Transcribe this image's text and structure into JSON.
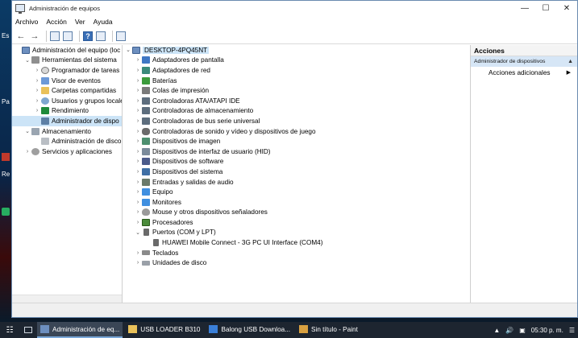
{
  "desktop": {
    "frag_1": "Es",
    "frag_2": "Pa",
    "frag_3": "Re"
  },
  "window": {
    "title": "Administración de equipos",
    "controls": {
      "minimize": "—",
      "maximize": "☐",
      "close": "✕"
    }
  },
  "menu": [
    "Archivo",
    "Acción",
    "Ver",
    "Ayuda"
  ],
  "left_tree": [
    {
      "label": "Administración del equipo (loc",
      "arrow": "",
      "icon": "ico-comp",
      "indent": 0
    },
    {
      "label": "Herramientas del sistema",
      "arrow": "⌄",
      "icon": "ico-tools",
      "indent": 1
    },
    {
      "label": "Programador de tareas",
      "arrow": "›",
      "icon": "ico-clock",
      "indent": 2
    },
    {
      "label": "Visor de eventos",
      "arrow": "›",
      "icon": "ico-event",
      "indent": 2
    },
    {
      "label": "Carpetas compartidas",
      "arrow": "›",
      "icon": "ico-folder",
      "indent": 2
    },
    {
      "label": "Usuarios y grupos locale",
      "arrow": "›",
      "icon": "ico-users",
      "indent": 2
    },
    {
      "label": "Rendimiento",
      "arrow": "›",
      "icon": "ico-perf",
      "indent": 2
    },
    {
      "label": "Administrador de dispo",
      "arrow": "",
      "icon": "ico-device",
      "indent": 2,
      "selected": true
    },
    {
      "label": "Almacenamiento",
      "arrow": "⌄",
      "icon": "ico-storage",
      "indent": 1
    },
    {
      "label": "Administración de disco",
      "arrow": "",
      "icon": "ico-disk",
      "indent": 2
    },
    {
      "label": "Servicios y aplicaciones",
      "arrow": "›",
      "icon": "ico-services",
      "indent": 1
    }
  ],
  "device_tree": {
    "root": "DESKTOP-4PQ45NT",
    "items": [
      {
        "label": "Adaptadores de pantalla",
        "arrow": "›",
        "icon": "ico-display",
        "indent": 1
      },
      {
        "label": "Adaptadores de red",
        "arrow": "›",
        "icon": "ico-net",
        "indent": 1
      },
      {
        "label": "Baterías",
        "arrow": "›",
        "icon": "ico-battery",
        "indent": 1
      },
      {
        "label": "Colas de impresión",
        "arrow": "›",
        "icon": "ico-print",
        "indent": 1
      },
      {
        "label": "Controladoras ATA/ATAPI IDE",
        "arrow": "›",
        "icon": "ico-ctrl",
        "indent": 1
      },
      {
        "label": "Controladoras de almacenamiento",
        "arrow": "›",
        "icon": "ico-ctrl",
        "indent": 1
      },
      {
        "label": "Controladoras de bus serie universal",
        "arrow": "›",
        "icon": "ico-ctrl",
        "indent": 1
      },
      {
        "label": "Controladoras de sonido y vídeo y dispositivos de juego",
        "arrow": "›",
        "icon": "ico-sound",
        "indent": 1
      },
      {
        "label": "Dispositivos de imagen",
        "arrow": "›",
        "icon": "ico-image",
        "indent": 1
      },
      {
        "label": "Dispositivos de interfaz de usuario (HID)",
        "arrow": "›",
        "icon": "ico-hid",
        "indent": 1
      },
      {
        "label": "Dispositivos de software",
        "arrow": "›",
        "icon": "ico-soft",
        "indent": 1
      },
      {
        "label": "Dispositivos del sistema",
        "arrow": "›",
        "icon": "ico-sys",
        "indent": 1
      },
      {
        "label": "Entradas y salidas de audio",
        "arrow": "›",
        "icon": "ico-audio",
        "indent": 1
      },
      {
        "label": "Equipo",
        "arrow": "›",
        "icon": "ico-monitor",
        "indent": 1
      },
      {
        "label": "Monitores",
        "arrow": "›",
        "icon": "ico-monitor",
        "indent": 1
      },
      {
        "label": "Mouse y otros dispositivos señaladores",
        "arrow": "›",
        "icon": "ico-mouse",
        "indent": 1
      },
      {
        "label": "Procesadores",
        "arrow": "›",
        "icon": "ico-cpu",
        "indent": 1
      },
      {
        "label": "Puertos (COM y LPT)",
        "arrow": "⌄",
        "icon": "ico-port",
        "indent": 1
      },
      {
        "label": "HUAWEI Mobile Connect - 3G PC UI Interface (COM4)",
        "arrow": "",
        "icon": "ico-port",
        "indent": 2
      },
      {
        "label": "Teclados",
        "arrow": "›",
        "icon": "ico-kbd",
        "indent": 1
      },
      {
        "label": "Unidades de disco",
        "arrow": "›",
        "icon": "ico-hdd",
        "indent": 1
      }
    ]
  },
  "actions": {
    "header": "Acciones",
    "section": "Administrador de dispositivos",
    "item": "Acciones adicionales"
  },
  "taskbar": {
    "items": [
      {
        "label": "Administración de eq...",
        "active": true,
        "color": "#6d8fbf"
      },
      {
        "label": "USB LOADER B310",
        "active": false,
        "color": "#e9c15a"
      },
      {
        "label": "Balong USB Downloa...",
        "active": false,
        "color": "#3a7fd8"
      },
      {
        "label": "Sin título - Paint",
        "active": false,
        "color": "#d8a040"
      }
    ],
    "clock": "05:30 p. m."
  }
}
